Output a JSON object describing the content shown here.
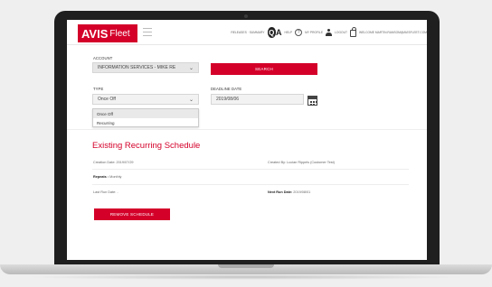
{
  "header": {
    "brand_main": "AVIS",
    "brand_sub": "Fleet",
    "nav_release": "RELEASES · SUMMARY",
    "nav_help": "HELP",
    "nav_profile": "MY PROFILE",
    "nav_logout": "LOGOUT",
    "nav_welcome": "WELCOME MARTIN.RANSOM@AVISFLEET.COM"
  },
  "form": {
    "account_label": "ACCOUNT",
    "account_value": "INFORMATION SERVICES - MIKE RE",
    "search_label": "SEARCH",
    "type_label": "TYPE",
    "type_value": "Once Off",
    "type_options": [
      "Once Off",
      "Recurring"
    ],
    "deadline_label": "DEADLINE DATE",
    "deadline_value": "2019/08/06"
  },
  "schedule": {
    "title": "Existing Recurring Schedule",
    "creation_date": "Creation Date: 2019/07/29",
    "created_by": "Created By: Lucian Rippels (Customer Test)",
    "repeats_label": "Repeats :",
    "repeats_value": "Monthly",
    "last_run_label": "Last Run Date: -",
    "next_run_label": "Next Run Date:",
    "next_run_value": "2019/08/01",
    "remove_label": "REMOVE SCHEDULE"
  },
  "colors": {
    "accent": "#d4002a",
    "laptop_frame": "#1f1f1f"
  }
}
